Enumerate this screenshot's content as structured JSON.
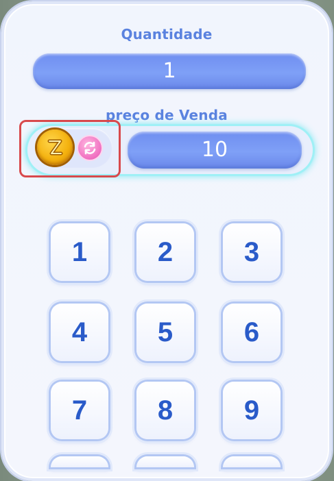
{
  "sell_panel": {
    "quantity_label": "Quantidade",
    "quantity_value": "1",
    "price_label": "preço de Venda",
    "price_value": "10",
    "currency_icon": "gold-coin-icon",
    "swap_currency_icon": "swap-arrows-icon"
  },
  "keypad": {
    "keys": [
      "1",
      "2",
      "3",
      "4",
      "5",
      "6",
      "7",
      "8",
      "9"
    ]
  },
  "colors": {
    "label": "#5a82df",
    "bar": "#7a9af5",
    "key_text": "#2a5bc9",
    "highlight": "#d8494c",
    "glow": "#7fe8f2"
  }
}
